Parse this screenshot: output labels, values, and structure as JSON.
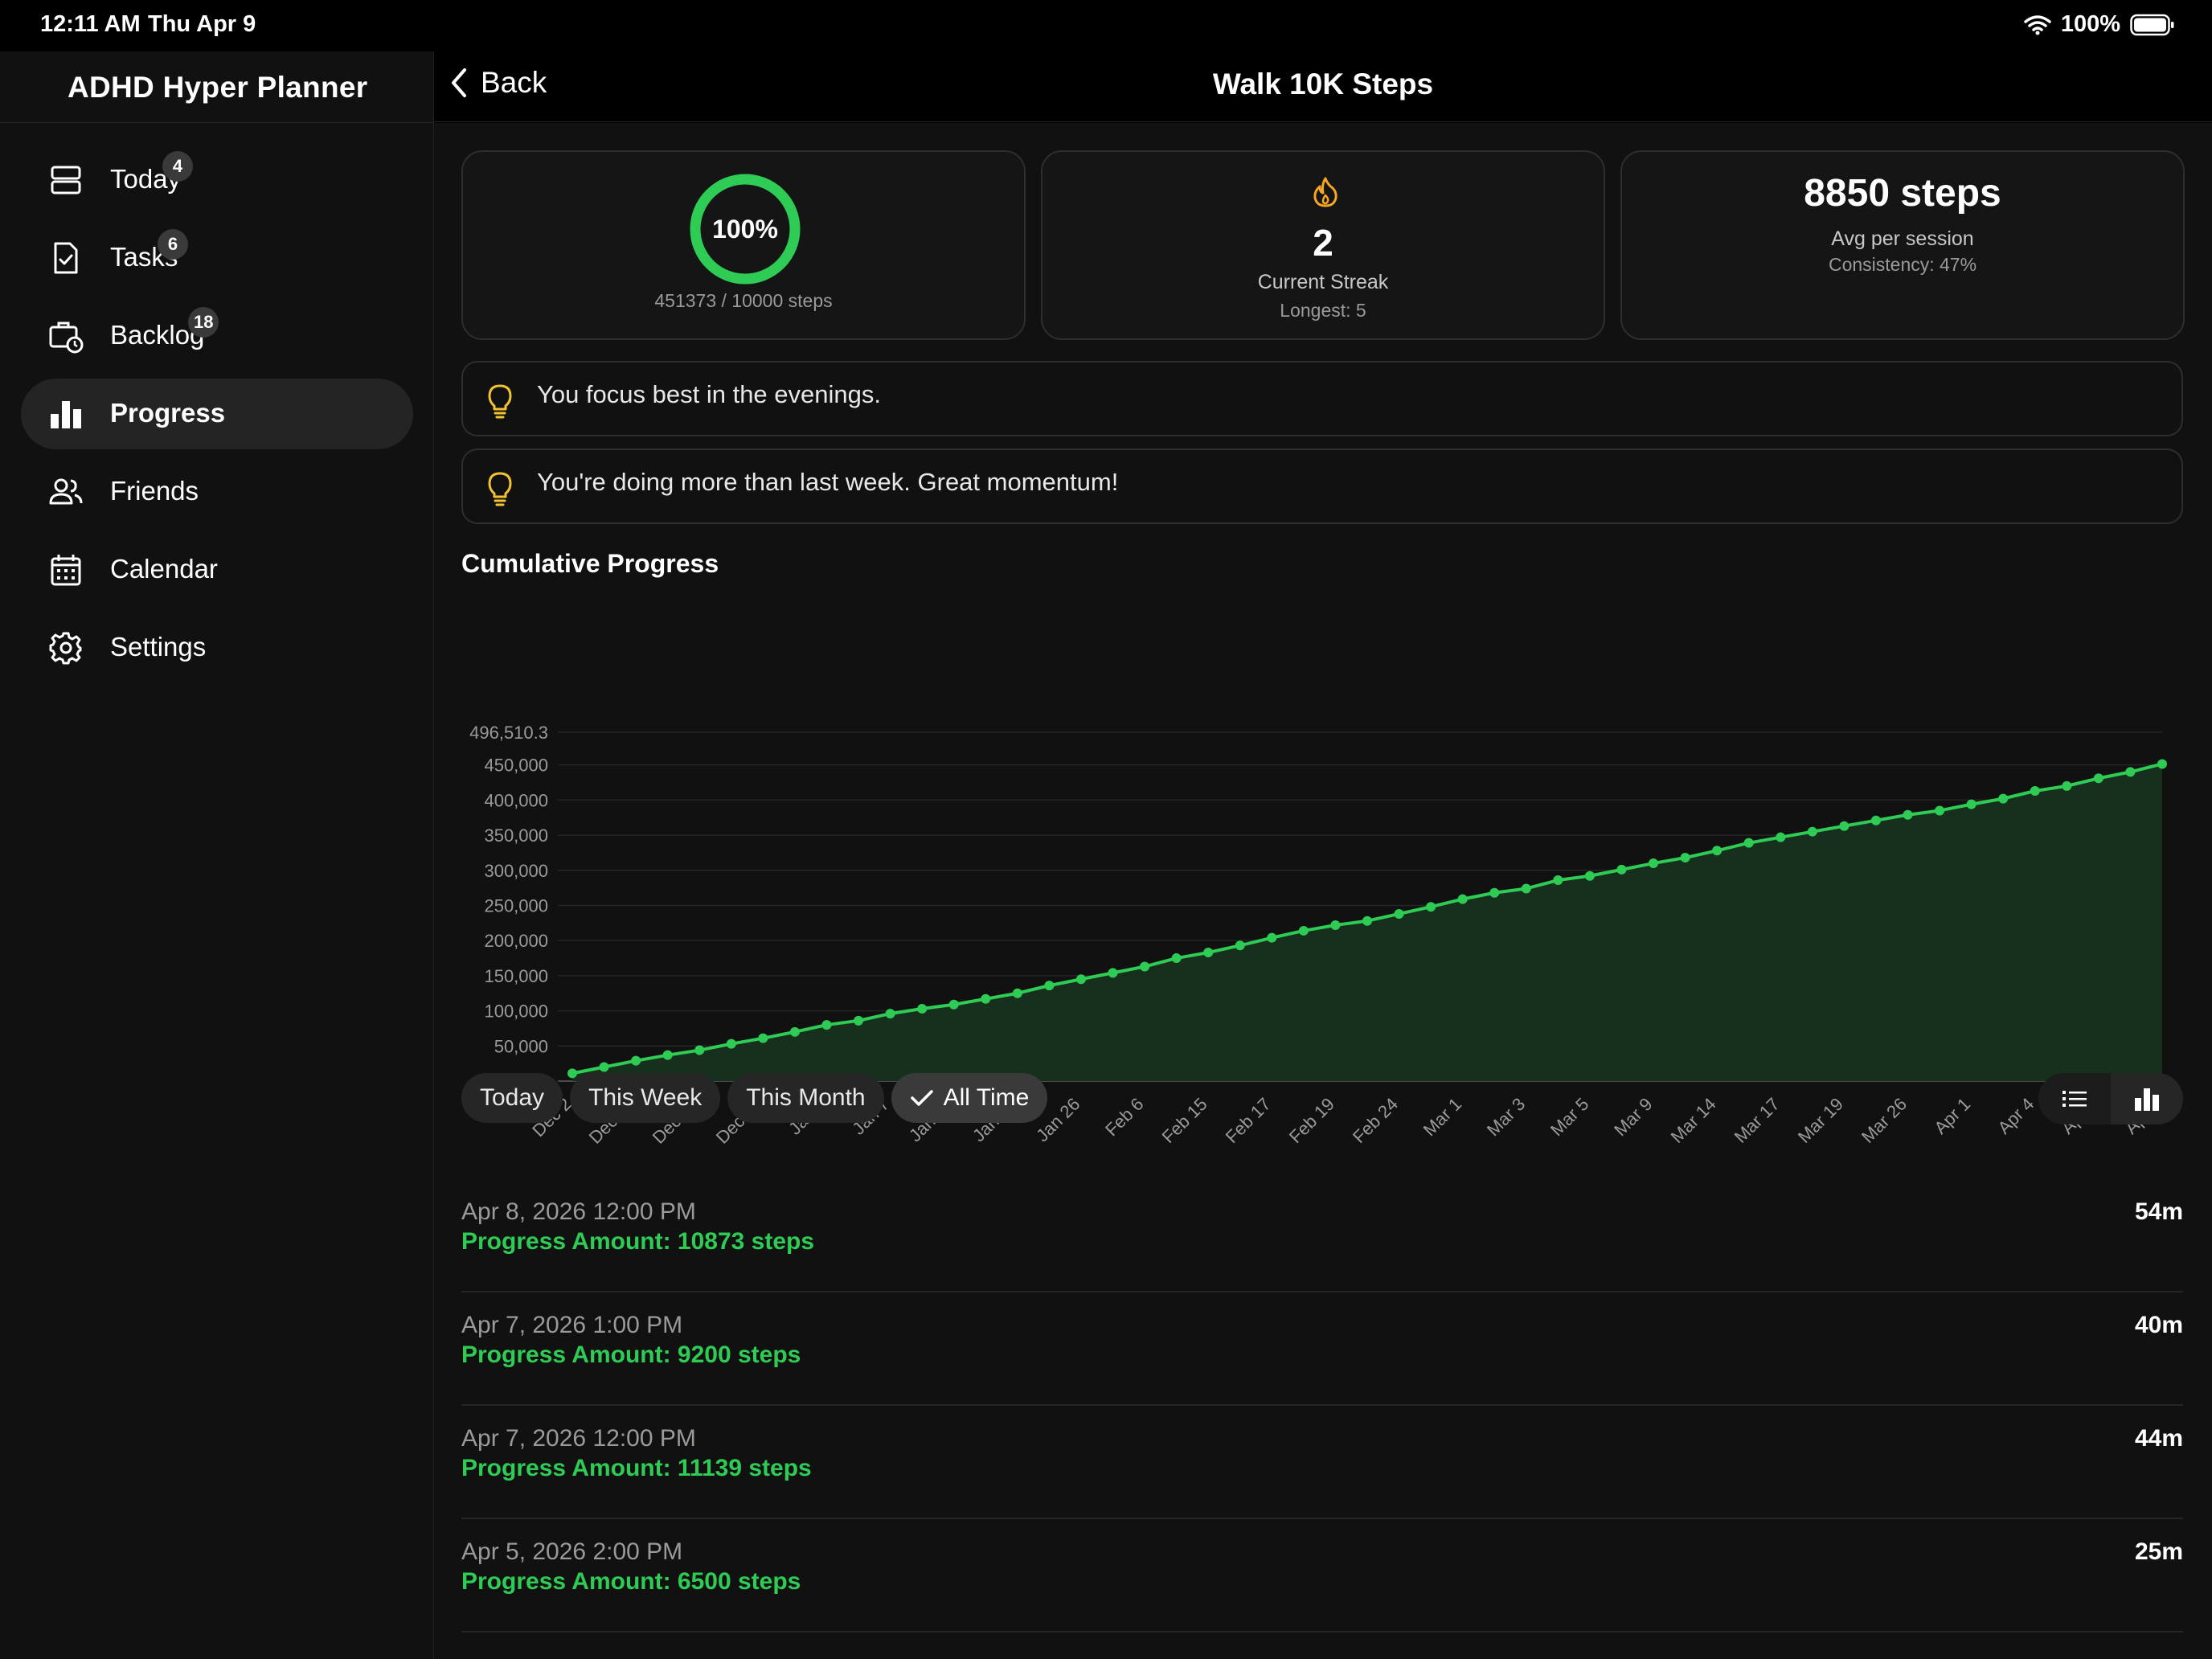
{
  "status_bar": {
    "time": "12:11 AM",
    "date": "Thu Apr 9",
    "battery": "100%"
  },
  "sidebar": {
    "app_title": "ADHD Hyper Planner",
    "items": [
      {
        "label": "Today",
        "badge": "4",
        "icon": "today-icon"
      },
      {
        "label": "Tasks",
        "badge": "6",
        "icon": "tasks-icon"
      },
      {
        "label": "Backlog",
        "badge": "18",
        "icon": "backlog-icon"
      },
      {
        "label": "Progress",
        "badge": "",
        "icon": "progress-icon",
        "active": true
      },
      {
        "label": "Friends",
        "badge": "",
        "icon": "friends-icon"
      },
      {
        "label": "Calendar",
        "badge": "",
        "icon": "calendar-icon"
      },
      {
        "label": "Settings",
        "badge": "",
        "icon": "settings-icon"
      }
    ]
  },
  "header": {
    "back_label": "Back",
    "title": "Walk 10K Steps"
  },
  "stats": {
    "completion": {
      "percent_label": "100%",
      "percent": 100,
      "detail": "451373 / 10000 steps"
    },
    "streak": {
      "value": "2",
      "label": "Current Streak",
      "longest": "Longest: 5"
    },
    "average": {
      "value": "8850 steps",
      "label": "Avg per session",
      "consistency": "Consistency: 47%"
    }
  },
  "insights": [
    "You focus best in the evenings.",
    "You're doing more than last week. Great momentum!"
  ],
  "chart_title": "Cumulative Progress",
  "chart_data": {
    "type": "area",
    "title": "Cumulative Progress",
    "ylim": [
      0,
      496510.3
    ],
    "y_ticks": [
      "496,510.3",
      "450,000",
      "400,000",
      "350,000",
      "300,000",
      "250,000",
      "200,000",
      "150,000",
      "100,000",
      "50,000",
      "0"
    ],
    "y_tick_values": [
      496510.3,
      450000,
      400000,
      350000,
      300000,
      250000,
      200000,
      150000,
      100000,
      50000,
      0
    ],
    "x_ticks": [
      "Dec 2",
      "Dec 12",
      "Dec 22",
      "Dec 29",
      "Jan 1",
      "Jan 7",
      "Jan 14",
      "Jan 20",
      "Jan 26",
      "Feb 6",
      "Feb 15",
      "Feb 17",
      "Feb 19",
      "Feb 24",
      "Mar 1",
      "Mar 3",
      "Mar 5",
      "Mar 9",
      "Mar 14",
      "Mar 17",
      "Mar 19",
      "Mar 26",
      "Apr 1",
      "Apr 4",
      "Apr 7",
      "Apr 8"
    ],
    "grid": true,
    "line_color": "#2ecc55",
    "fill_color": "#17301d",
    "series": [
      {
        "values": [
          11000,
          20000,
          29000,
          37000,
          44000,
          53000,
          61000,
          70000,
          80000,
          86000,
          96000,
          103000,
          109000,
          117000,
          125000,
          136000,
          145000,
          154000,
          163000,
          175000,
          183000,
          193000,
          204000,
          214000,
          222000,
          228000,
          238000,
          248000,
          259000,
          268000,
          274000,
          286000,
          292000,
          301000,
          310000,
          318000,
          328000,
          339000,
          347000,
          355000,
          363000,
          371000,
          379000,
          385000,
          394000,
          402000,
          413000,
          420000,
          431000,
          440000,
          451373
        ]
      }
    ]
  },
  "filters": [
    {
      "label": "Today",
      "active": false
    },
    {
      "label": "This Week",
      "active": false
    },
    {
      "label": "This Month",
      "active": false
    },
    {
      "label": "All Time",
      "active": true
    }
  ],
  "entries": [
    {
      "date": "Apr 8, 2026 12:00 PM",
      "amount": "Progress Amount: 10873 steps",
      "duration": "54m"
    },
    {
      "date": "Apr 7, 2026 1:00 PM",
      "amount": "Progress Amount: 9200 steps",
      "duration": "40m"
    },
    {
      "date": "Apr 7, 2026 12:00 PM",
      "amount": "Progress Amount: 11139 steps",
      "duration": "44m"
    },
    {
      "date": "Apr 5, 2026 2:00 PM",
      "amount": "Progress Amount: 6500 steps",
      "duration": "25m"
    }
  ],
  "colors": {
    "accent": "#2ecc55",
    "streak": "#f5a623",
    "bulb": "#f2c230"
  }
}
